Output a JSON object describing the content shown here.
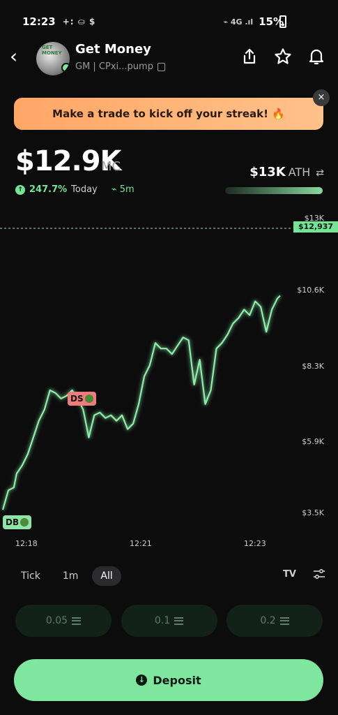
{
  "status_bar": {
    "time": "12:23",
    "left_icons": "+: ⛀ $",
    "battery": "15%"
  },
  "header": {
    "title": "Get Money",
    "subtitle": "GM | CPxi...pump",
    "avatar_caption": "GET MONEY"
  },
  "banner": {
    "text": "Make a trade to kick off your streak! 🔥",
    "close": "×"
  },
  "stats": {
    "market_cap": "$12.9K",
    "unit": "MC",
    "change": "247.7%",
    "change_label": "Today",
    "timeframe": "5m",
    "ath_value": "$13K",
    "ath_label": "ATH"
  },
  "chart_data": {
    "type": "line",
    "y_ticks": [
      "$13K",
      "$10.6K",
      "$8.3K",
      "$5.9K",
      "$3.5K"
    ],
    "x_ticks": [
      "12:18",
      "12:21",
      "12:23"
    ],
    "current_price": "$12,937",
    "ylim": [
      2700,
      13500
    ],
    "x": [
      0,
      2,
      4,
      5,
      7,
      9,
      11,
      13,
      15,
      17,
      19,
      21,
      23,
      25,
      27,
      29,
      31,
      33,
      35,
      37,
      39,
      41,
      43,
      45,
      47,
      49,
      51,
      53,
      55,
      57,
      59,
      61,
      63,
      65,
      67,
      69,
      71,
      73,
      75,
      77,
      79,
      81,
      83,
      85,
      87,
      89,
      91,
      93,
      95,
      97,
      99,
      100
    ],
    "values": [
      3200,
      3900,
      4000,
      4500,
      4800,
      5200,
      5800,
      6400,
      6800,
      7500,
      7400,
      7200,
      7300,
      7500,
      7200,
      6800,
      5800,
      6600,
      6700,
      6500,
      6600,
      6400,
      6600,
      6100,
      6300,
      7000,
      8000,
      8400,
      9200,
      9000,
      9000,
      8800,
      9100,
      9400,
      9300,
      7700,
      8600,
      7000,
      7500,
      9000,
      9200,
      9500,
      9900,
      10100,
      10400,
      10200,
      10700,
      10500,
      9600,
      10400,
      10800,
      10900
    ],
    "marker_ds": "DS",
    "marker_db": "DB"
  },
  "tabs": [
    "Tick",
    "1m",
    "All"
  ],
  "tab_icons": {
    "tradingview": "TV"
  },
  "amounts": [
    "0.05",
    "0.1",
    "0.2"
  ],
  "deposit": {
    "label": "Deposit",
    "icon": "↓"
  },
  "colors": {
    "accent": "#74e596",
    "banner": "#ffb070",
    "sell": "#f07b7b"
  }
}
